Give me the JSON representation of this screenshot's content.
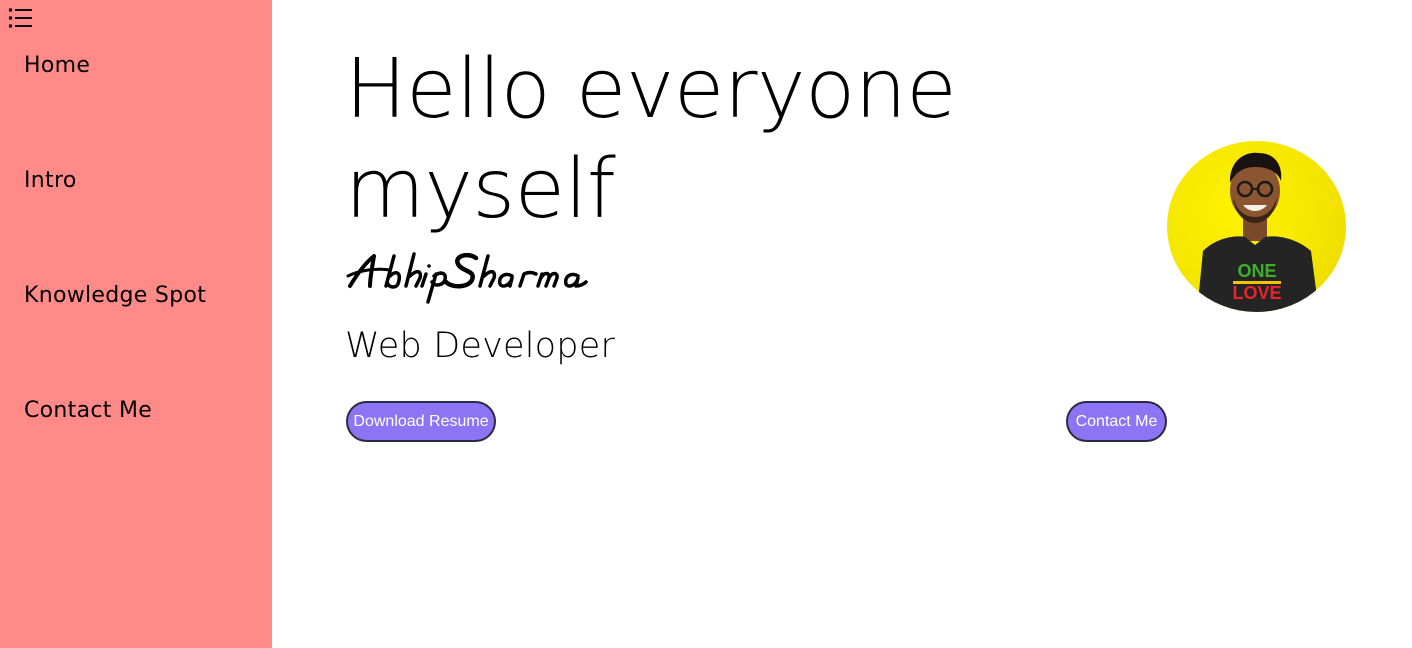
{
  "sidebar": {
    "menu_icon": "list-icon",
    "background": "#ff8a87",
    "items": [
      {
        "label": "Home"
      },
      {
        "label": "Intro"
      },
      {
        "label": "Knowledge Spot"
      },
      {
        "label": "Contact Me"
      }
    ]
  },
  "hero": {
    "greeting_line1": "Hello everyone",
    "greeting_line2": "myself",
    "signature": "Abhip Sharma",
    "role": "Web Developer",
    "avatar_shirt_text_top": "ONE",
    "avatar_shirt_text_bottom": "LOVE"
  },
  "buttons": {
    "download_label": "Download Resume",
    "contact_label": "Contact Me",
    "accent": "#8c74f4"
  }
}
